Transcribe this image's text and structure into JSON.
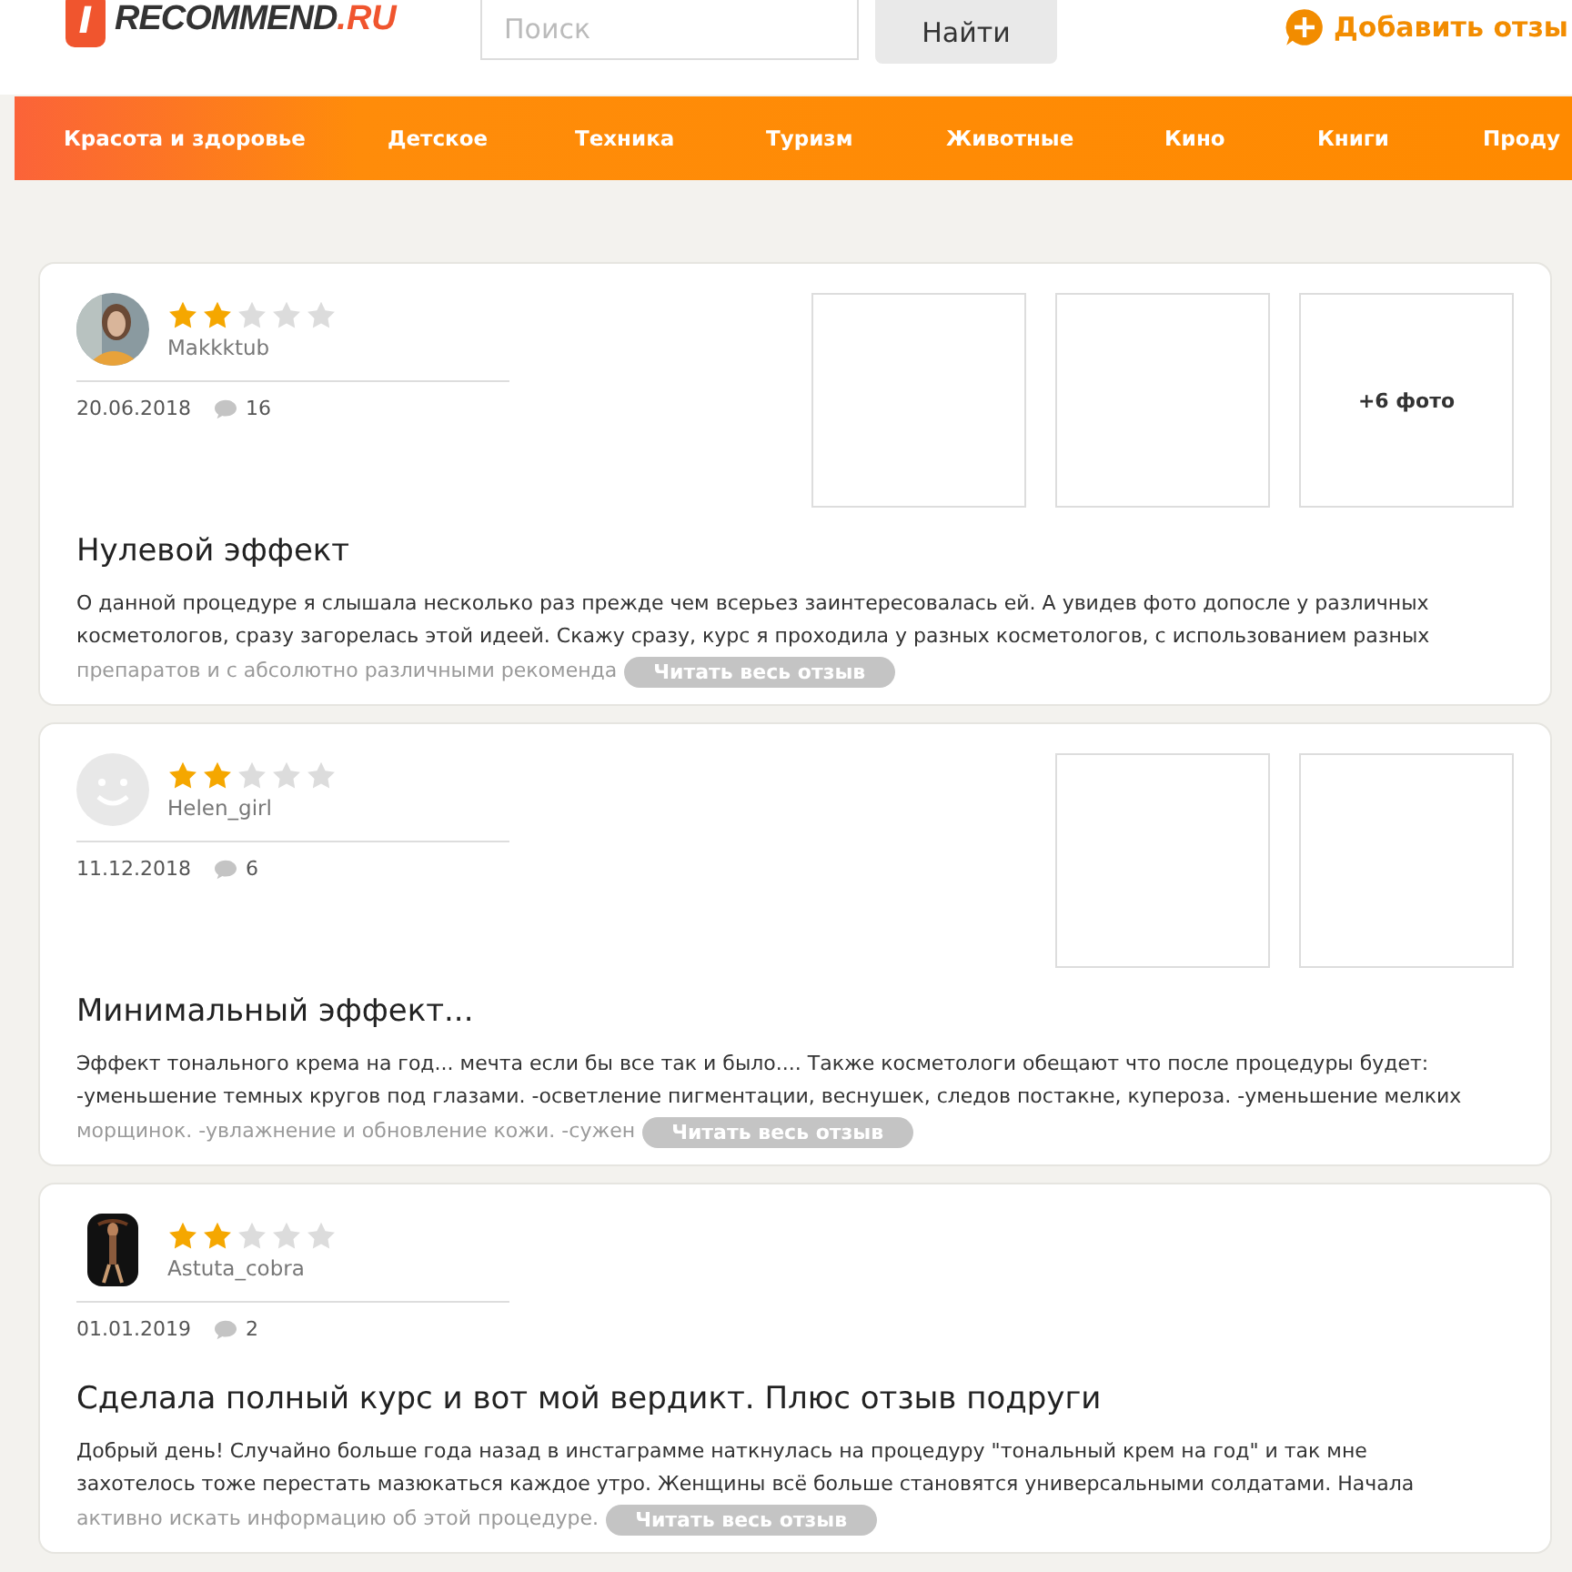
{
  "header": {
    "logo": {
      "mark": "I",
      "name": "RECOMMEND",
      "domain": ".RU"
    },
    "search": {
      "placeholder": "Поиск"
    },
    "search_button": "Найти",
    "add_review": "Добавить отзы"
  },
  "nav": [
    {
      "label": "Красота и здоровье"
    },
    {
      "label": "Детское"
    },
    {
      "label": "Техника"
    },
    {
      "label": "Туризм"
    },
    {
      "label": "Животные"
    },
    {
      "label": "Кино"
    },
    {
      "label": "Книги"
    },
    {
      "label": "Проду"
    }
  ],
  "reviews": [
    {
      "user": "Makkktub",
      "stars": 2,
      "date": "20.06.2018",
      "comments": "16",
      "photos": [
        {
          "kind": "empty"
        },
        {
          "kind": "empty"
        },
        {
          "kind": "more",
          "label": "+6 фото"
        }
      ],
      "title": "Нулевой эффект",
      "lines": [
        "О данной процедуре я слышала несколько раз прежде чем всерьез заинтересовалась ей. А увидев фото допосле у различных",
        "косметологов, сразу загорелась этой идеей. Скажу сразу, курс я проходила у разных косметологов, с использованием разных"
      ],
      "faded": "препаратов и с абсолютно различными рекоменда",
      "read_more": "Читать весь отзыв"
    },
    {
      "kind": "default",
      "user": "Helen_girl",
      "stars": 2,
      "date": "11.12.2018",
      "comments": "6",
      "photos": [
        {
          "kind": "empty"
        },
        {
          "kind": "empty"
        }
      ],
      "title": "Минимальный эффект...",
      "lines": [
        "Эффект тонального крема на год... мечта если бы все так и было.... Также косметологи обещают что после процедуры будет:",
        "-уменьшение темных кругов под глазами. -осветление пигментации, веснушек, следов постакне, купероза. -уменьшение мелких"
      ],
      "faded": "морщинок. -увлажнение и обновление кожи. -сужен",
      "read_more": "Читать весь отзыв"
    },
    {
      "user": "Astuta_cobra",
      "stars": 2,
      "date": "01.01.2019",
      "comments": "2",
      "title": "Сделала полный курс и вот мой вердикт. Плюс отзыв подруги",
      "lines": [
        "Добрый день! Случайно больше года назад в инстаграмме наткнулась на процедуру \"тональный крем на год\" и так мне",
        "захотелось тоже перестать мазюкаться каждое утро. Женщины всё больше становятся универсальными солдатами. Начала"
      ],
      "faded": "активно искать информацию об этой процедуре.",
      "read_more": "Читать весь отзыв"
    }
  ]
}
